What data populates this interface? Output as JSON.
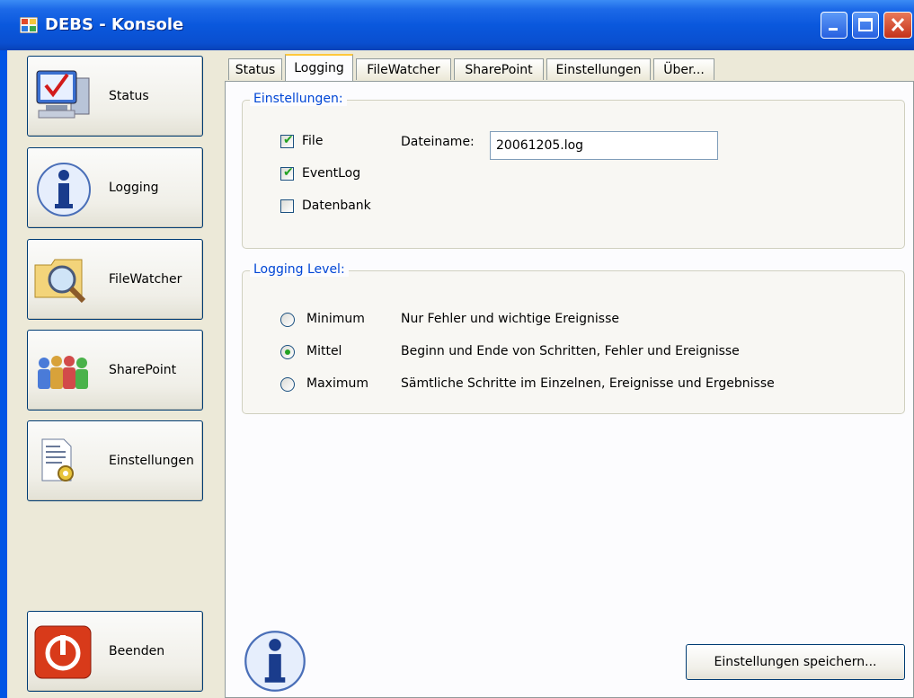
{
  "window": {
    "title": "DEBS - Konsole"
  },
  "sidebar": {
    "items": [
      {
        "label": "Status",
        "icon": "monitor-check-icon"
      },
      {
        "label": "Logging",
        "icon": "info-icon"
      },
      {
        "label": "FileWatcher",
        "icon": "folder-search-icon"
      },
      {
        "label": "SharePoint",
        "icon": "people-icon"
      },
      {
        "label": "Einstellungen",
        "icon": "settings-document-icon"
      }
    ],
    "exit": {
      "label": "Beenden",
      "icon": "power-icon"
    }
  },
  "tabs": [
    "Status",
    "Logging",
    "FileWatcher",
    "SharePoint",
    "Einstellungen",
    "Über..."
  ],
  "active_tab": "Logging",
  "settings_group": {
    "title": "Einstellungen:",
    "file_label": "File",
    "file_checked": true,
    "eventlog_label": "EventLog",
    "eventlog_checked": true,
    "datenbank_label": "Datenbank",
    "datenbank_checked": false,
    "filename_label": "Dateiname:",
    "filename_value": "20061205.log"
  },
  "level_group": {
    "title": "Logging Level:",
    "options": [
      {
        "label": "Minimum",
        "description": "Nur Fehler und wichtige Ereignisse",
        "selected": false
      },
      {
        "label": "Mittel",
        "description": "Beginn und Ende von Schritten, Fehler und Ereignisse",
        "selected": true
      },
      {
        "label": "Maximum",
        "description": "Sämtliche Schritte im Einzelnen, Ereignisse und Ergebnisse",
        "selected": false
      }
    ]
  },
  "save_button": "Einstellungen speichern...",
  "colors": {
    "titlebar": "#0a58dd",
    "accent": "#0046d5",
    "check": "#21a121",
    "close": "#c4321a"
  }
}
